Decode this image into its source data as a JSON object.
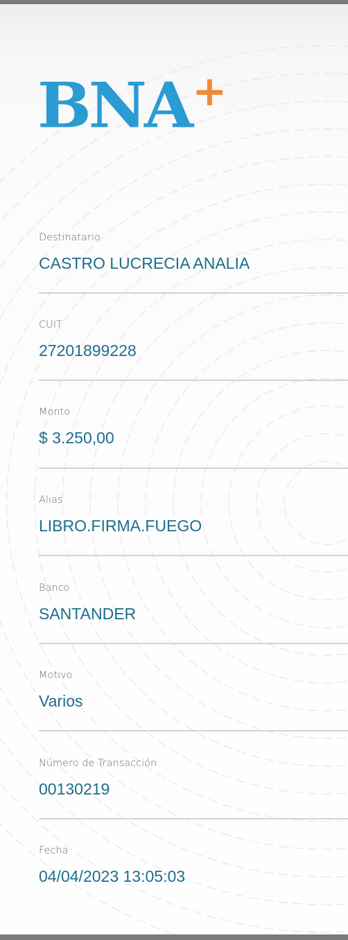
{
  "logo": {
    "text": "BNA",
    "plus": "+"
  },
  "colors": {
    "brand_blue": "#2b9bd3",
    "brand_orange": "#ee8b3a",
    "value_text": "#1d6e8c",
    "label_text": "#6b6b6b"
  },
  "fields": [
    {
      "label": "Destinatario",
      "value": "CASTRO LUCRECIA ANALIA"
    },
    {
      "label": "CUIT",
      "value": "27201899228"
    },
    {
      "label": "Monto",
      "value": "$ 3.250,00"
    },
    {
      "label": "Alias",
      "value": "LIBRO.FIRMA.FUEGO"
    },
    {
      "label": "Banco",
      "value": "SANTANDER"
    },
    {
      "label": "Motivo",
      "value": "Varios"
    },
    {
      "label": "Número de Transacción",
      "value": "00130219"
    },
    {
      "label": "Fecha",
      "value": "04/04/2023 13:05:03"
    }
  ]
}
